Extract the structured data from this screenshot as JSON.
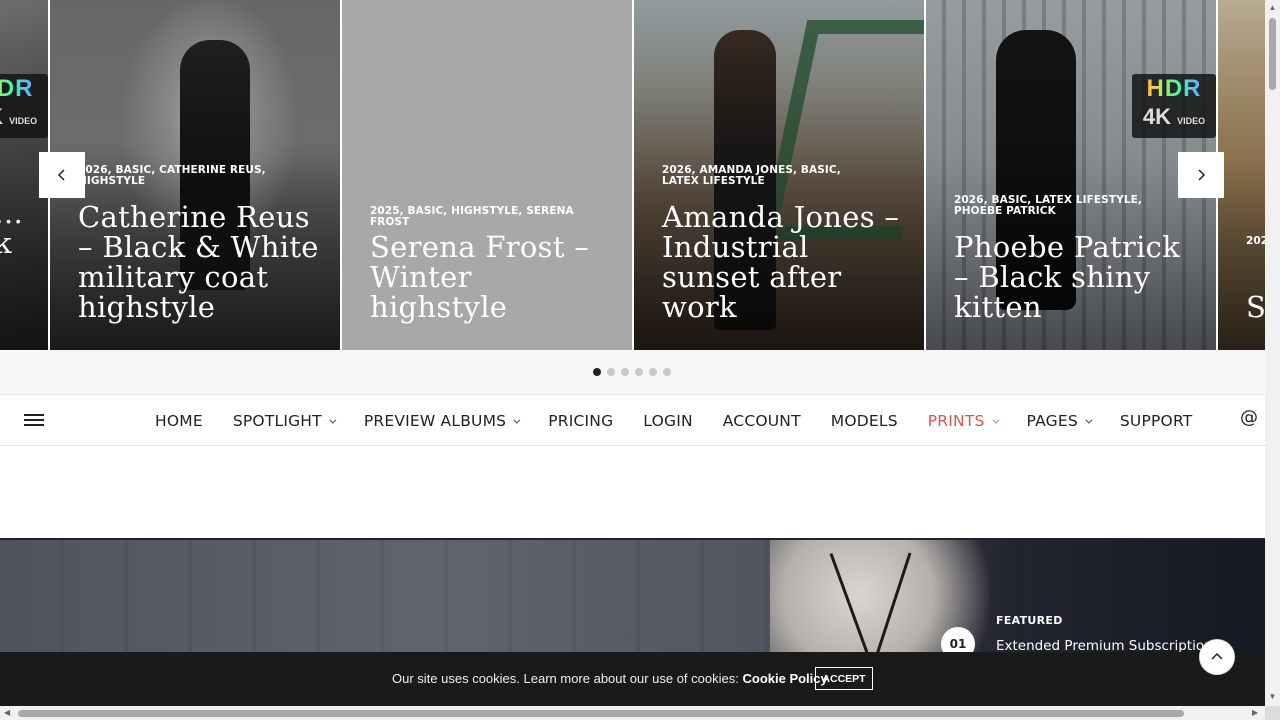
{
  "carousel": {
    "slides": [
      {
        "meta": [],
        "title": "…k"
      },
      {
        "meta": [
          "2026",
          "BASIC",
          "CATHERINE REUS",
          "HIGHSTYLE"
        ],
        "title": "Catherine Reus – Black & White military coat highstyle"
      },
      {
        "meta": [
          "2025",
          "BASIC",
          "HIGHSTYLE",
          "SERENA FROST"
        ],
        "title": "Serena Frost – Winter highstyle"
      },
      {
        "meta": [
          "2026",
          "AMANDA JONES",
          "BASIC",
          "LATEX LIFESTYLE"
        ],
        "title": "Amanda Jones – Industrial sunset after work"
      },
      {
        "meta": [
          "2026",
          "BASIC",
          "LATEX LIFESTYLE",
          "PHOEBE PATRICK"
        ],
        "title": "Phoebe Patrick – Black shiny kitten"
      },
      {
        "meta": [
          "202"
        ],
        "title": "S W"
      }
    ],
    "badge": {
      "hdr": "HDR",
      "k4": "4K",
      "video": "VIDEO"
    },
    "dots_count": 6,
    "active_dot": 0
  },
  "nav": {
    "items": [
      {
        "label": "HOME",
        "has_submenu": false,
        "active": false
      },
      {
        "label": "SPOTLIGHT",
        "has_submenu": true,
        "active": false
      },
      {
        "label": "PREVIEW ALBUMS",
        "has_submenu": true,
        "active": false
      },
      {
        "label": "PRICING",
        "has_submenu": false,
        "active": false
      },
      {
        "label": "LOGIN",
        "has_submenu": false,
        "active": false
      },
      {
        "label": "ACCOUNT",
        "has_submenu": false,
        "active": false
      },
      {
        "label": "MODELS",
        "has_submenu": false,
        "active": false
      },
      {
        "label": "PRINTS",
        "has_submenu": true,
        "active": true
      },
      {
        "label": "PAGES",
        "has_submenu": true,
        "active": false
      },
      {
        "label": "SUPPORT",
        "has_submenu": false,
        "active": false
      }
    ],
    "at_symbol": "@"
  },
  "featured": {
    "label": "FEATURED",
    "number": "01",
    "title": "Extended Premium Subscription"
  },
  "cookie": {
    "text": "Our site uses cookies. Learn more about our use of cookies:",
    "link": "Cookie Policy",
    "accept": "ACCEPT"
  },
  "colors": {
    "accent": "#d9534f",
    "text": "#222222",
    "cookie_bg": "#1a1a1a"
  }
}
